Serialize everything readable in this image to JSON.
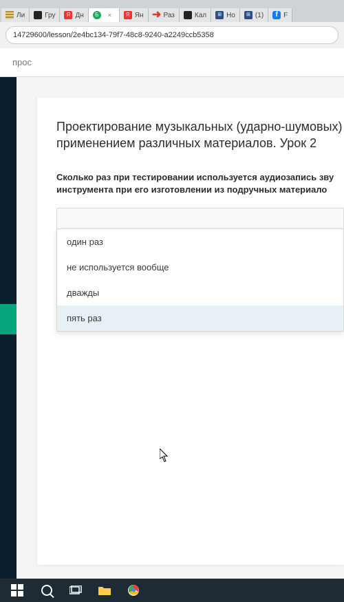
{
  "browser": {
    "url": "14729600/lesson/2e4bc134-79f7-48c8-9240-a2249ccb5358",
    "tabs": [
      {
        "label": "Ли",
        "favicon": "stripe"
      },
      {
        "label": "Гру",
        "favicon": "black"
      },
      {
        "label": "Дн",
        "favicon": "yred"
      },
      {
        "label": "",
        "favicon": "green",
        "active": true
      },
      {
        "label": "Ян",
        "favicon": "yred"
      },
      {
        "label": "Раз",
        "favicon": "arrow"
      },
      {
        "label": "Кал",
        "favicon": "black"
      },
      {
        "label": "Но",
        "favicon": "blue"
      },
      {
        "label": "(1)",
        "favicon": "blue"
      },
      {
        "label": "F",
        "favicon": "fb"
      }
    ]
  },
  "toolbar": {
    "label": "прос"
  },
  "lesson": {
    "title": "Проектирование музыкальных (ударно-шумовых) применением различных материалов. Урок 2",
    "question": "Сколько раз при тестировании используется аудиозапись зву инструмента при его изготовлении из подручных материало",
    "options": [
      "один раз",
      "не используется вообще",
      "дважды",
      "пять раз"
    ]
  }
}
